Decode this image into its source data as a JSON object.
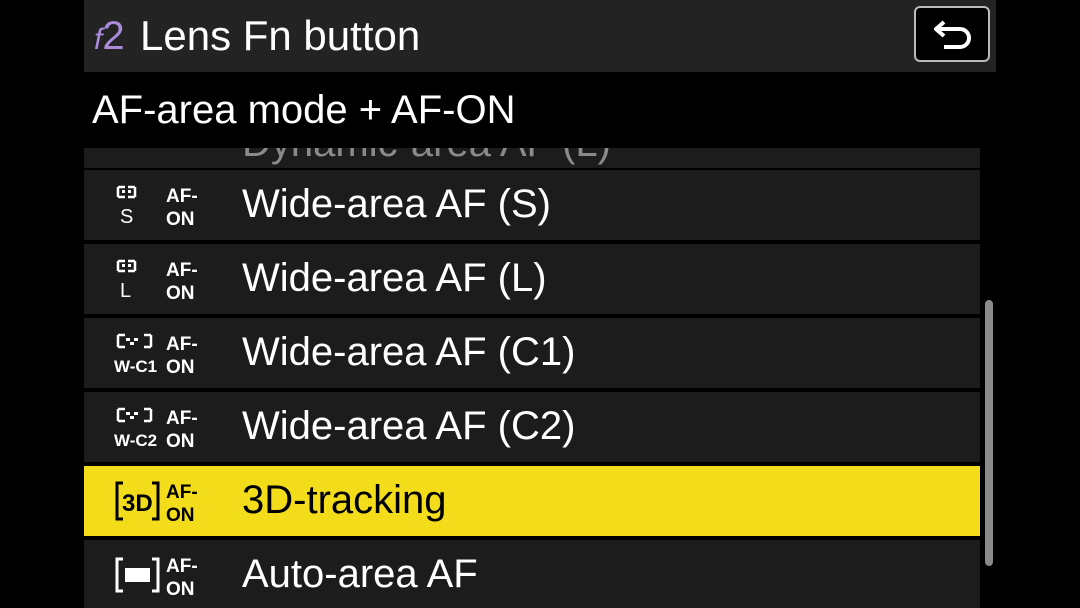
{
  "header": {
    "prefix_letter": "f",
    "prefix_number": "2",
    "title": "Lens Fn button",
    "back_icon": "return-arrow-icon"
  },
  "subtitle": "AF-area mode + AF-ON",
  "menu": {
    "partial_item": "Dynamic-area AF (L)",
    "items": [
      {
        "label": "Wide-area AF (S)",
        "icon": "wide-area-s-af-on-icon",
        "mode_code": "S"
      },
      {
        "label": "Wide-area AF (L)",
        "icon": "wide-area-l-af-on-icon",
        "mode_code": "L"
      },
      {
        "label": "Wide-area AF (C1)",
        "icon": "wide-area-c1-af-on-icon",
        "mode_code": "W-C1"
      },
      {
        "label": "Wide-area AF (C2)",
        "icon": "wide-area-c2-af-on-icon",
        "mode_code": "W-C2"
      },
      {
        "label": "3D-tracking",
        "icon": "3d-tracking-af-on-icon",
        "mode_code": "3D",
        "selected": true
      },
      {
        "label": "Auto-area AF",
        "icon": "auto-area-af-on-icon",
        "mode_code": ""
      }
    ],
    "af_on_line1": "AF-",
    "af_on_line2": "ON"
  },
  "colors": {
    "highlight": "#f3dc19",
    "title_prefix": "#a98bd9",
    "row_bg": "#1c1c1c",
    "title_bg": "#232323"
  }
}
